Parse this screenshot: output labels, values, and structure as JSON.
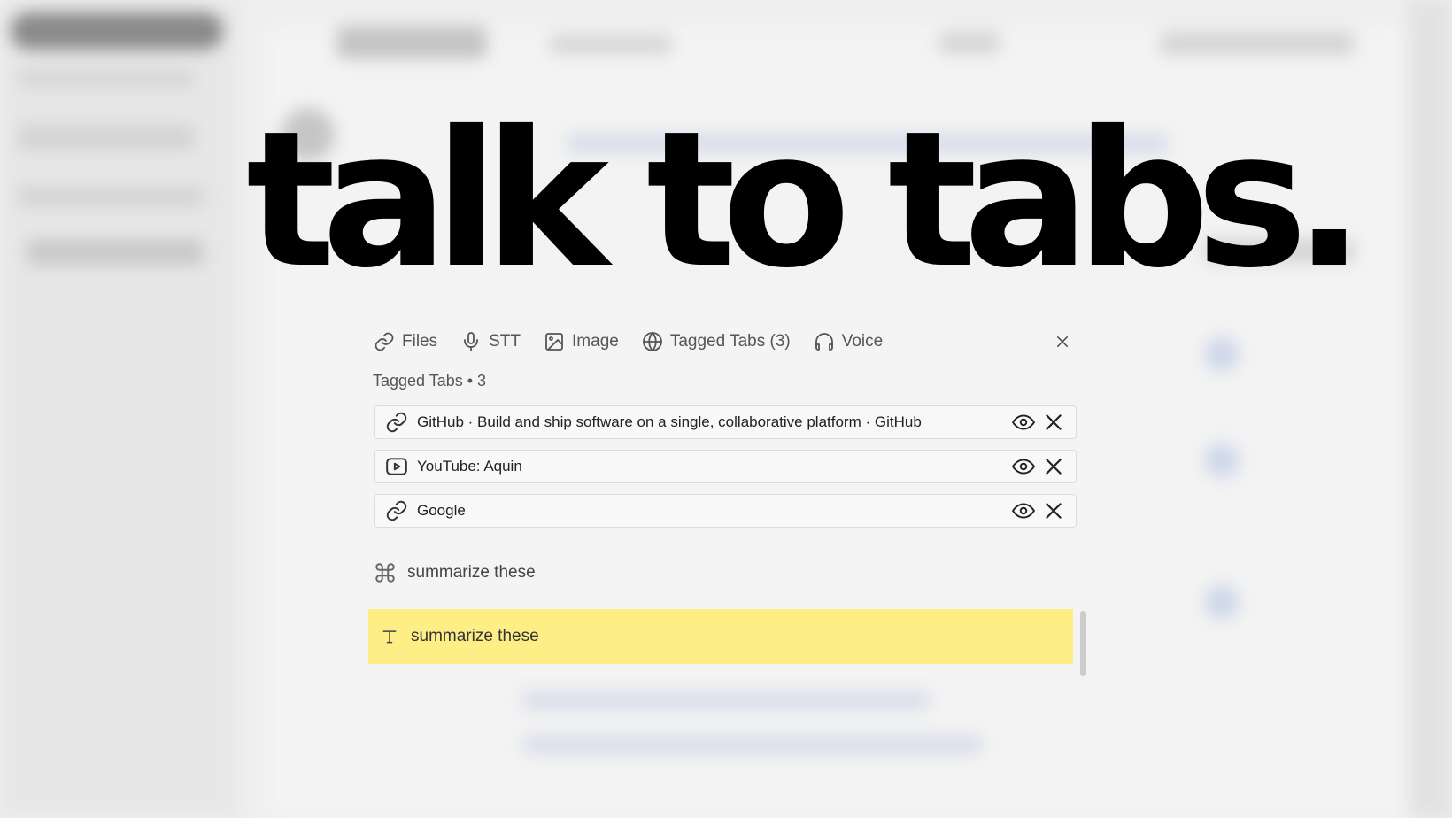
{
  "headline": "talk to tabs.",
  "toolbar": {
    "items": [
      {
        "label": "Files",
        "icon": "link-icon"
      },
      {
        "label": "STT",
        "icon": "microphone-icon"
      },
      {
        "label": "Image",
        "icon": "image-icon"
      },
      {
        "label": "Tagged Tabs (3)",
        "icon": "globe-icon"
      },
      {
        "label": "Voice",
        "icon": "headphones-icon"
      }
    ],
    "close_icon": "close-icon"
  },
  "tagged_tabs": {
    "title": "Tagged Tabs • 3",
    "items": [
      {
        "title": "GitHub · Build and ship software on a single, collaborative platform · GitHub",
        "icon": "link-icon"
      },
      {
        "title": "YouTube: Aquin",
        "icon": "youtube-icon"
      },
      {
        "title": "Google",
        "icon": "link-icon"
      }
    ]
  },
  "suggestion": {
    "label": "summarize these",
    "icon": "command-icon"
  },
  "input": {
    "value": "summarize these",
    "icon": "text-icon"
  },
  "colors": {
    "highlight": "#fdee86",
    "headline": "#000000",
    "panel": "#f4f4f4"
  }
}
